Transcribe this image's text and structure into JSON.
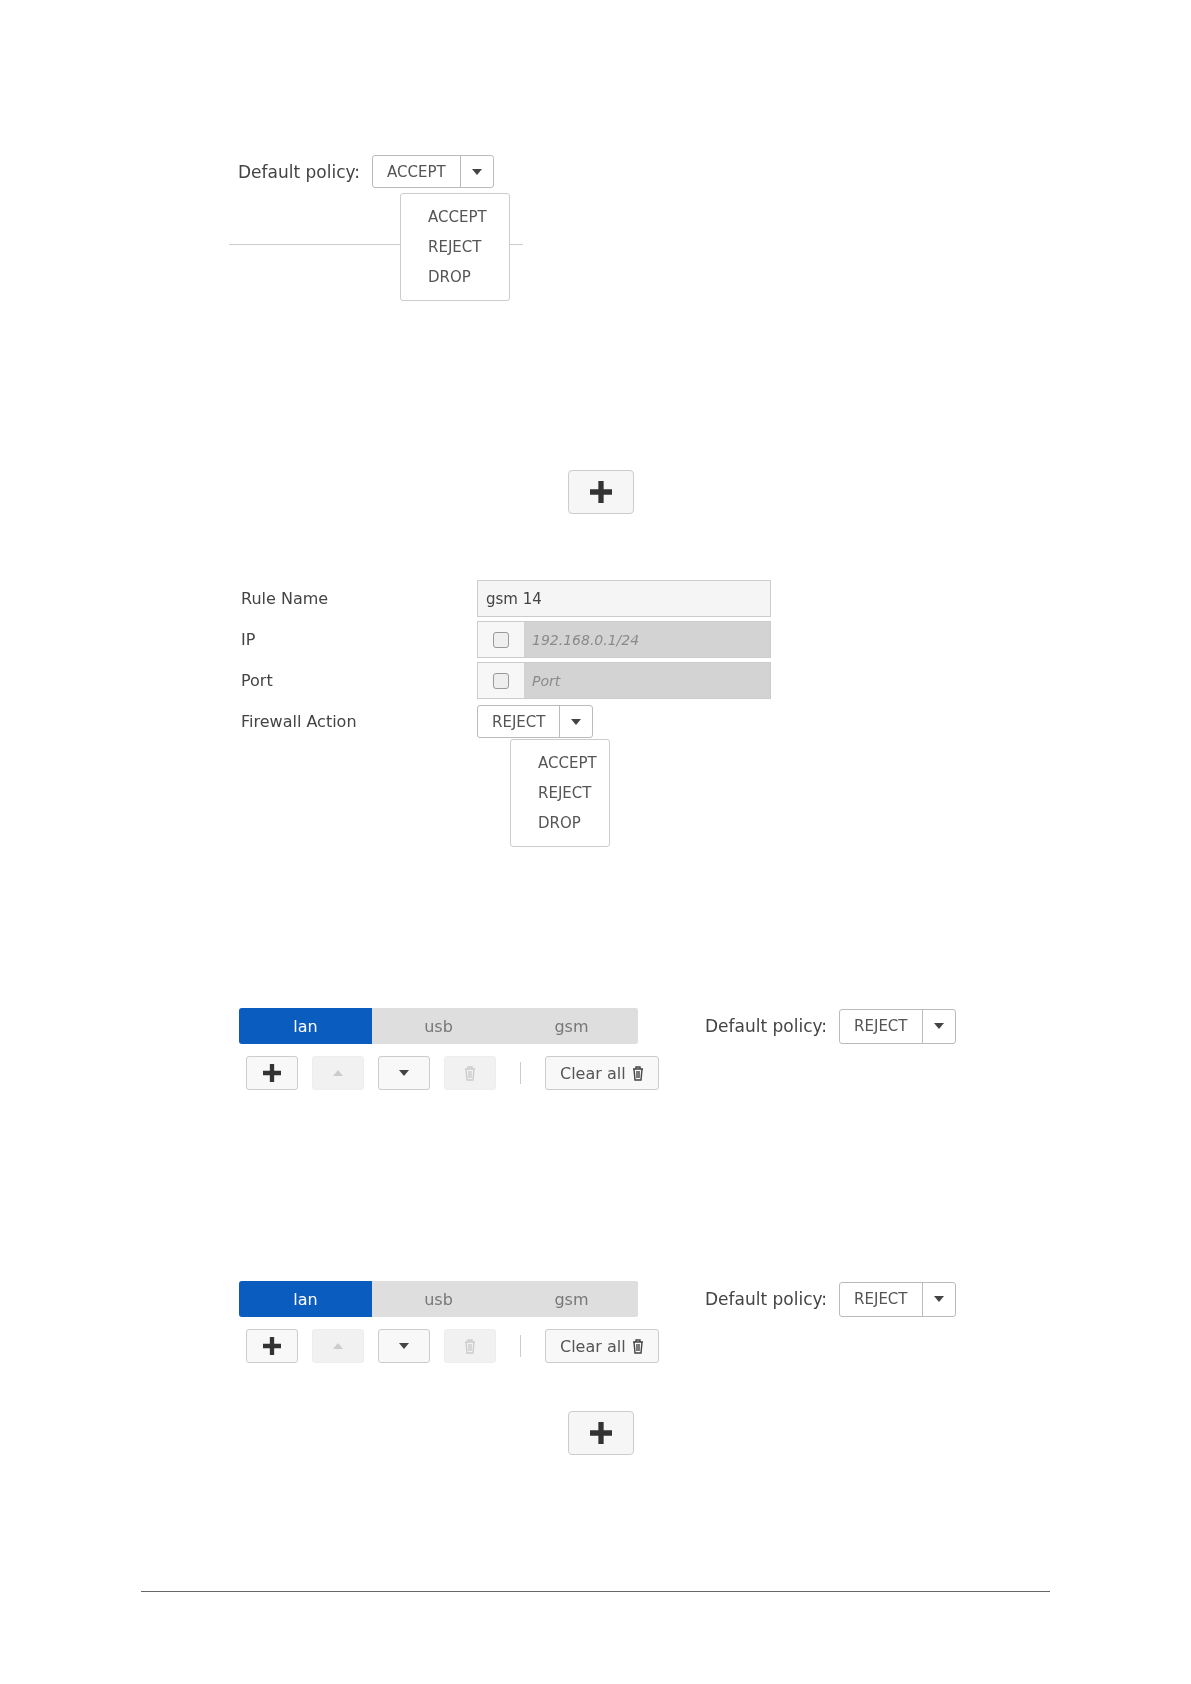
{
  "sections": [
    {
      "kind": "policy_select",
      "label": "Default policy:",
      "value": "ACCEPT",
      "expanded": true,
      "options": [
        {
          "label": "ACCEPT"
        },
        {
          "label": "REJECT"
        },
        {
          "label": "DROP"
        }
      ]
    },
    {
      "kind": "add_button"
    },
    {
      "kind": "rule_form",
      "rows": [
        {
          "kind": "text",
          "label": "Rule Name",
          "value": "gsm 14"
        },
        {
          "kind": "checked_input",
          "label": "IP",
          "checked": false,
          "placeholder": "192.168.0.1/24"
        },
        {
          "kind": "checked_input",
          "label": "Port",
          "checked": false,
          "placeholder": "Port"
        },
        {
          "kind": "select",
          "label": "Firewall Action",
          "value": "REJECT",
          "expanded": true,
          "options": [
            {
              "label": "ACCEPT"
            },
            {
              "label": "REJECT"
            },
            {
              "label": "DROP"
            }
          ]
        }
      ]
    },
    {
      "kind": "zone_toolbar",
      "tabs": [
        {
          "label": "lan",
          "selected": true
        },
        {
          "label": "usb",
          "selected": false
        },
        {
          "label": "gsm",
          "selected": false
        }
      ],
      "policy": {
        "label": "Default policy:",
        "value": "REJECT"
      },
      "buttons": [
        {
          "kind": "add",
          "disabled": false
        },
        {
          "kind": "up",
          "disabled": true
        },
        {
          "kind": "down",
          "disabled": false
        },
        {
          "kind": "delete",
          "disabled": true
        },
        {
          "kind": "clear",
          "label": "Clear all",
          "disabled": false
        }
      ]
    },
    {
      "kind": "zone_toolbar",
      "tabs": [
        {
          "label": "lan",
          "selected": true
        },
        {
          "label": "usb",
          "selected": false
        },
        {
          "label": "gsm",
          "selected": false
        }
      ],
      "policy": {
        "label": "Default policy:",
        "value": "REJECT"
      },
      "buttons": [
        {
          "kind": "add",
          "disabled": false
        },
        {
          "kind": "up",
          "disabled": true
        },
        {
          "kind": "down",
          "disabled": false
        },
        {
          "kind": "delete",
          "disabled": true
        },
        {
          "kind": "clear",
          "label": "Clear all",
          "disabled": false
        }
      ]
    },
    {
      "kind": "add_button"
    }
  ]
}
